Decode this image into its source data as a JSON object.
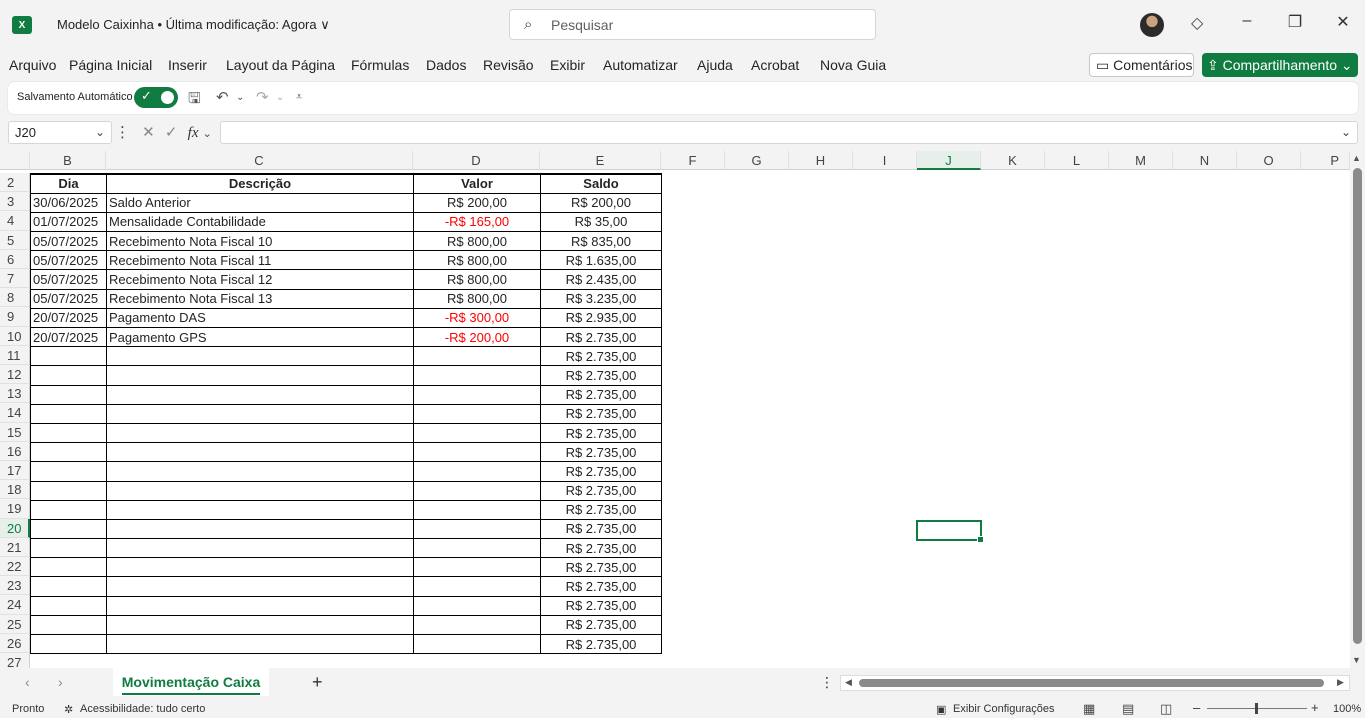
{
  "app": {
    "logo_letter": "X",
    "title": "Modelo Caixinha • Última modificação: Agora ∨",
    "search_placeholder": "Pesquisar"
  },
  "menu": [
    "Arquivo",
    "Página Inicial",
    "Inserir",
    "Layout da Página",
    "Fórmulas",
    "Dados",
    "Revisão",
    "Exibir",
    "Automatizar",
    "Ajuda",
    "Acrobat",
    "Nova Guia"
  ],
  "buttons": {
    "comments": "Comentários",
    "share": "Compartilhamento"
  },
  "quick_access": {
    "autosave_label": "Salvamento Automático"
  },
  "formula_bar": {
    "name_box": "J20",
    "fx": "fx",
    "value": ""
  },
  "columns": [
    "B",
    "C",
    "D",
    "E",
    "F",
    "G",
    "H",
    "I",
    "J",
    "K",
    "L",
    "M",
    "N",
    "O",
    "P"
  ],
  "selected_column": "J",
  "rows": [
    "2",
    "3",
    "4",
    "5",
    "6",
    "7",
    "8",
    "9",
    "10",
    "11",
    "12",
    "13",
    "14",
    "15",
    "16",
    "17",
    "18",
    "19",
    "20",
    "21",
    "22",
    "23",
    "24",
    "25",
    "26",
    "27"
  ],
  "selected_row": "20",
  "table": {
    "headers": [
      "Dia",
      "Descrição",
      "Valor",
      "Saldo"
    ],
    "rows": [
      [
        "30/06/2025",
        "Saldo Anterior",
        "R$ 200,00",
        "R$ 200,00"
      ],
      [
        "01/07/2025",
        "Mensalidade Contabilidade",
        "-R$ 165,00",
        "R$ 35,00"
      ],
      [
        "05/07/2025",
        "Recebimento Nota Fiscal 10",
        "R$ 800,00",
        "R$ 835,00"
      ],
      [
        "05/07/2025",
        "Recebimento Nota Fiscal 11",
        "R$ 800,00",
        "R$ 1.635,00"
      ],
      [
        "05/07/2025",
        "Recebimento Nota Fiscal 12",
        "R$ 800,00",
        "R$ 2.435,00"
      ],
      [
        "05/07/2025",
        "Recebimento Nota Fiscal 13",
        "R$ 800,00",
        "R$ 3.235,00"
      ],
      [
        "20/07/2025",
        "Pagamento DAS",
        "-R$ 300,00",
        "R$ 2.935,00"
      ],
      [
        "20/07/2025",
        "Pagamento GPS",
        "-R$ 200,00",
        "R$ 2.735,00"
      ],
      [
        "",
        "",
        "",
        "R$ 2.735,00"
      ],
      [
        "",
        "",
        "",
        "R$ 2.735,00"
      ],
      [
        "",
        "",
        "",
        "R$ 2.735,00"
      ],
      [
        "",
        "",
        "",
        "R$ 2.735,00"
      ],
      [
        "",
        "",
        "",
        "R$ 2.735,00"
      ],
      [
        "",
        "",
        "",
        "R$ 2.735,00"
      ],
      [
        "",
        "",
        "",
        "R$ 2.735,00"
      ],
      [
        "",
        "",
        "",
        "R$ 2.735,00"
      ],
      [
        "",
        "",
        "",
        "R$ 2.735,00"
      ],
      [
        "",
        "",
        "",
        "R$ 2.735,00"
      ],
      [
        "",
        "",
        "",
        "R$ 2.735,00"
      ],
      [
        "",
        "",
        "",
        "R$ 2.735,00"
      ],
      [
        "",
        "",
        "",
        "R$ 2.735,00"
      ],
      [
        "",
        "",
        "",
        "R$ 2.735,00"
      ],
      [
        "",
        "",
        "",
        "R$ 2.735,00"
      ],
      [
        "",
        "",
        "",
        "R$ 2.735,00"
      ]
    ]
  },
  "sheet_tab": "Movimentação Caixa",
  "status": {
    "ready": "Pronto",
    "accessibility": "Acessibilidade: tudo certo",
    "display_settings": "Exibir Configurações",
    "zoom": "100%"
  },
  "colors": {
    "accent": "#107c41",
    "negative": "#ff0000"
  }
}
